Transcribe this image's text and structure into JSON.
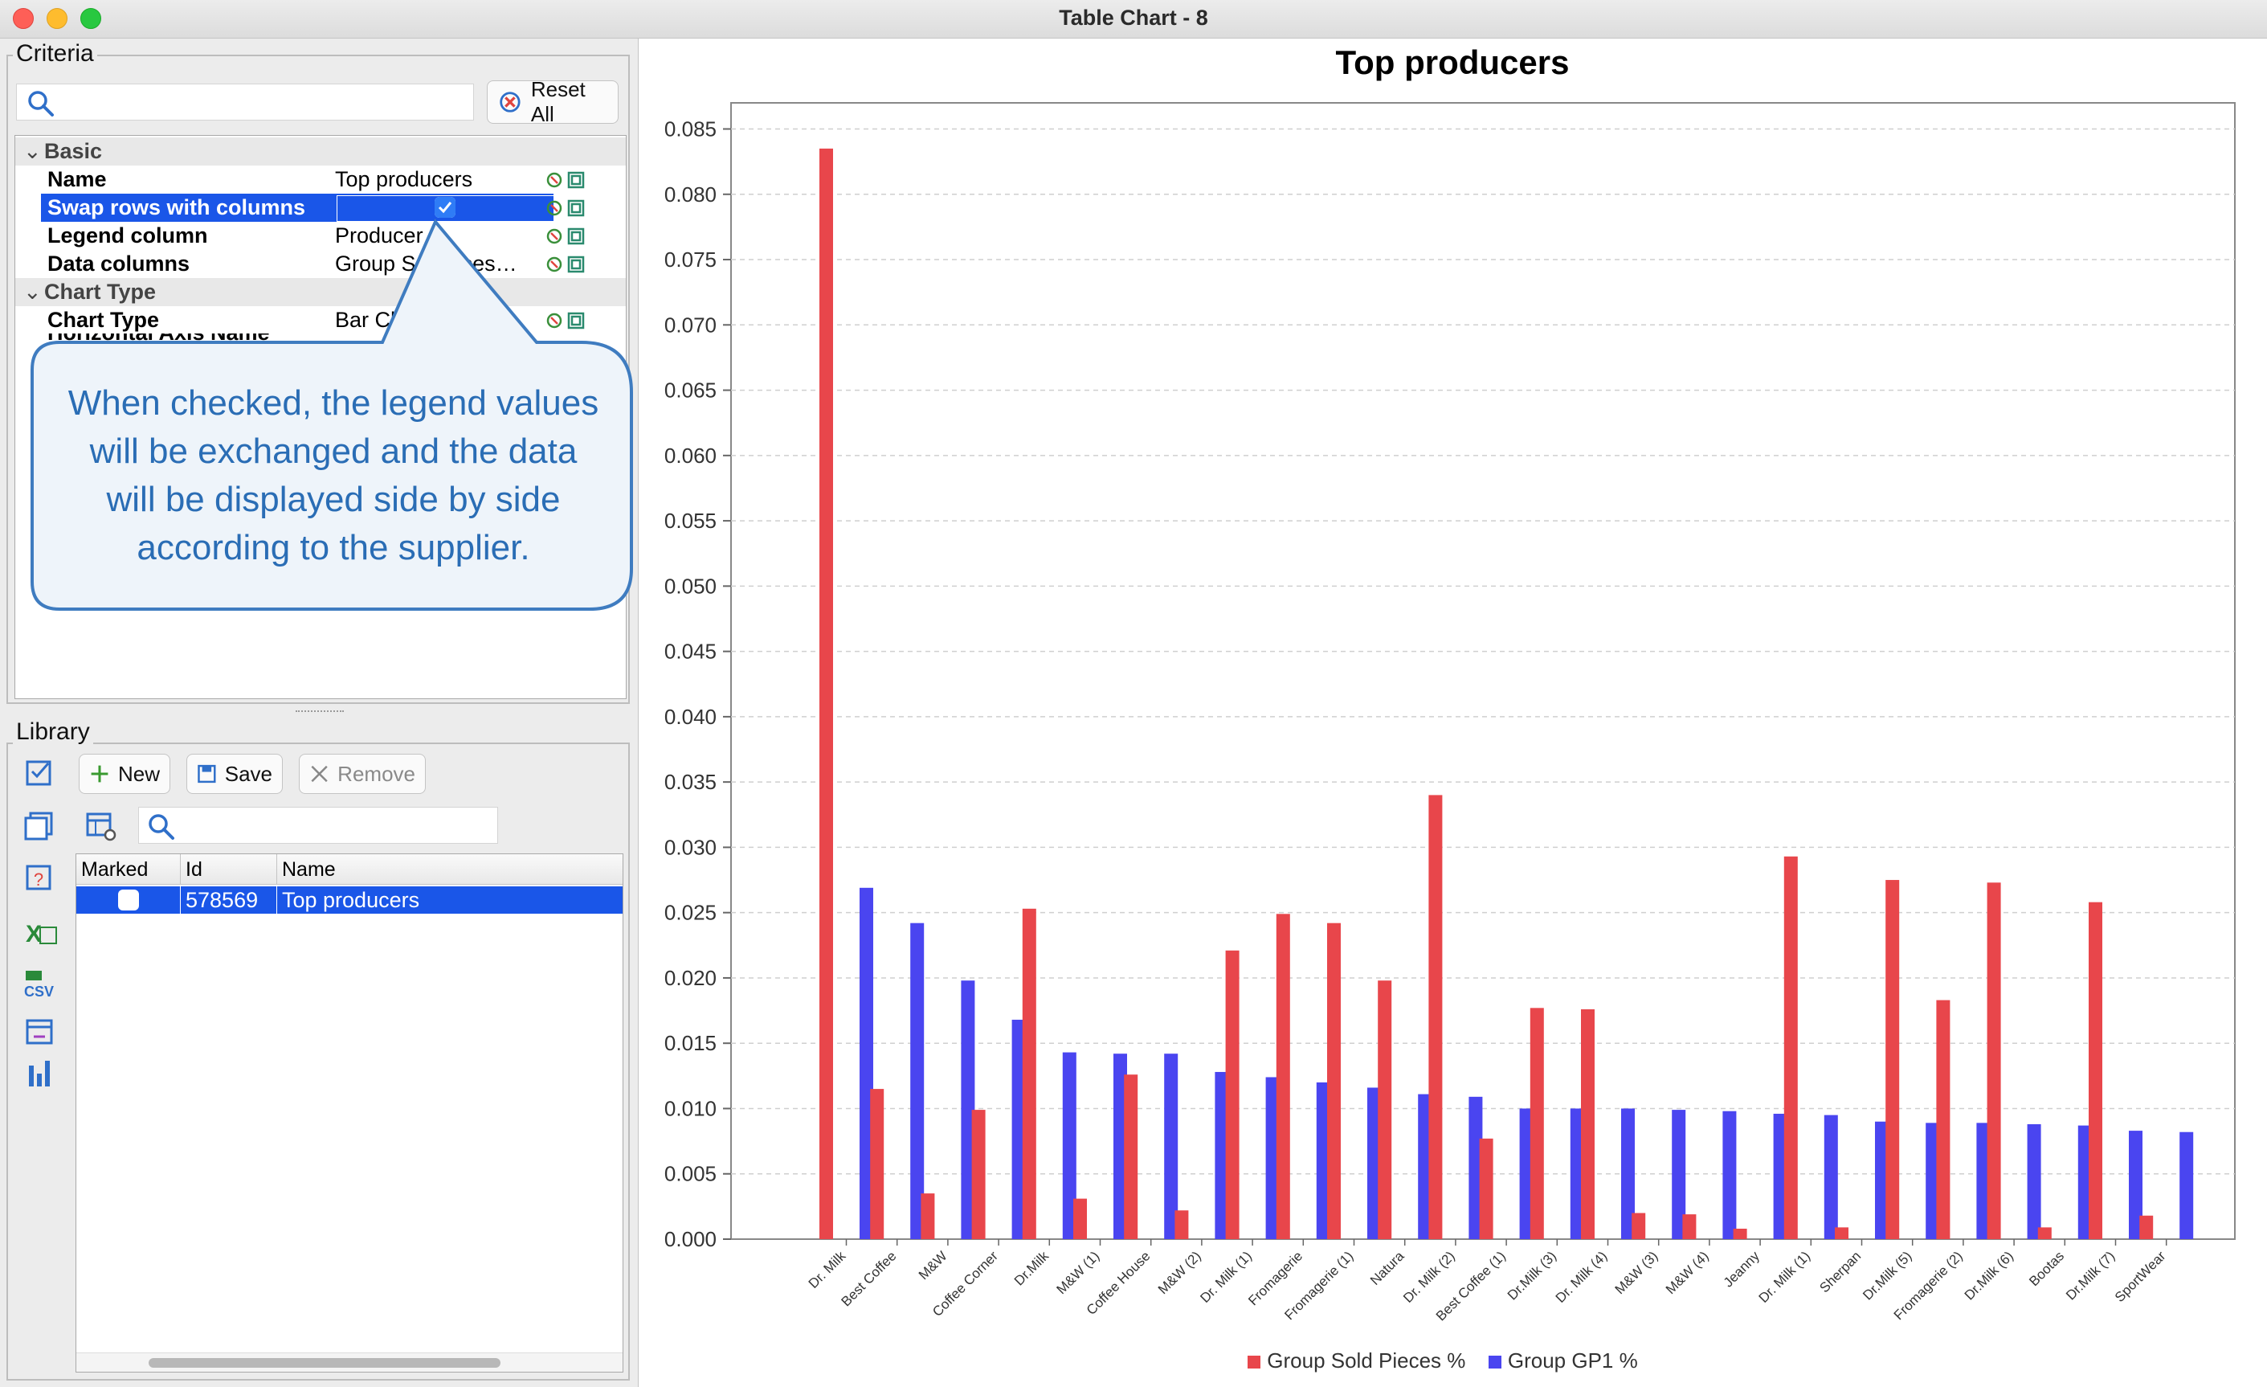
{
  "window": {
    "title": "Table Chart - 8"
  },
  "criteria": {
    "title": "Criteria",
    "search_placeholder": "",
    "reset_label": "Reset All",
    "categories": {
      "basic": "Basic",
      "chart_type": "Chart Type"
    },
    "properties": [
      {
        "name": "Name",
        "value": "Top producers"
      },
      {
        "name": "Swap rows with columns",
        "value": "",
        "checked": true
      },
      {
        "name": "Legend column",
        "value": "Producer"
      },
      {
        "name": "Data columns",
        "value": "Group So…eces…"
      },
      {
        "name": "Chart Type",
        "value": "Bar Ch"
      },
      {
        "name": "Horizontal Axis Name",
        "value": ""
      }
    ]
  },
  "callout": {
    "text": "When checked, the legend values will be exchanged and the data will be displayed side by side according to the supplier."
  },
  "library": {
    "title": "Library",
    "new_label": "New",
    "save_label": "Save",
    "remove_label": "Remove",
    "columns": [
      "Marked",
      "Id",
      "Name"
    ],
    "rows": [
      {
        "marked": false,
        "id": "578569",
        "name": "Top producers"
      }
    ]
  },
  "colors": {
    "red": "#e8464b",
    "blue": "#4a45f0",
    "selection": "#1a56e8",
    "callout": "#2a6db5"
  },
  "chart_data": {
    "type": "bar",
    "title": "Top producers",
    "ylim": [
      0,
      0.087
    ],
    "yticks": [
      "0.000",
      "0.005",
      "0.010",
      "0.015",
      "0.020",
      "0.025",
      "0.030",
      "0.035",
      "0.040",
      "0.045",
      "0.050",
      "0.055",
      "0.060",
      "0.065",
      "0.070",
      "0.075",
      "0.080",
      "0.085"
    ],
    "grid": true,
    "legend_position": "bottom",
    "categories": [
      "Dr. Milk",
      "Best Coffee",
      "M&W",
      "Coffee Corner",
      "Dr.Milk",
      "M&W (1)",
      "Coffee House",
      "M&W (2)",
      "Dr. Milk (1)",
      "Fromagerie",
      "Fromagerie (1)",
      "Natura",
      "Dr. Milk (2)",
      "Best Coffee (1)",
      "Dr.Milk (3)",
      "Dr. Milk (4)",
      "M&W (3)",
      "M&W (4)",
      "Jeanny",
      "Dr. Milk (1)",
      "Sherpan",
      "Dr.Milk (5)",
      "Fromagerie (2)",
      "Dr.Milk (6)",
      "Bootas",
      "Dr.Milk (7)",
      "SportWear"
    ],
    "series": [
      {
        "name": "Group Sold Pieces %",
        "color": "#e8464b",
        "values": [
          0.0835,
          0.0115,
          0.0035,
          0.0099,
          0.0253,
          0.0031,
          0.0126,
          0.0022,
          0.0221,
          0.0249,
          0.0242,
          0.0198,
          0.034,
          0.0077,
          0.0177,
          0.0176,
          0.002,
          0.0019,
          0.0008,
          0.0293,
          0.0009,
          0.0275,
          0.0183,
          0.0273,
          0.0009,
          0.0258,
          0.0018
        ]
      },
      {
        "name": "Group GP1 %",
        "color": "#4a45f0",
        "values": [
          0.0269,
          0.0242,
          0.0198,
          0.0168,
          0.0143,
          0.0142,
          0.0142,
          0.0128,
          0.0124,
          0.012,
          0.0116,
          0.0111,
          0.0109,
          0.01,
          0.01,
          0.01,
          0.0099,
          0.0098,
          0.0096,
          0.0095,
          0.009,
          0.0089,
          0.0089,
          0.0088,
          0.0087,
          0.0083,
          0.0082
        ]
      }
    ]
  }
}
